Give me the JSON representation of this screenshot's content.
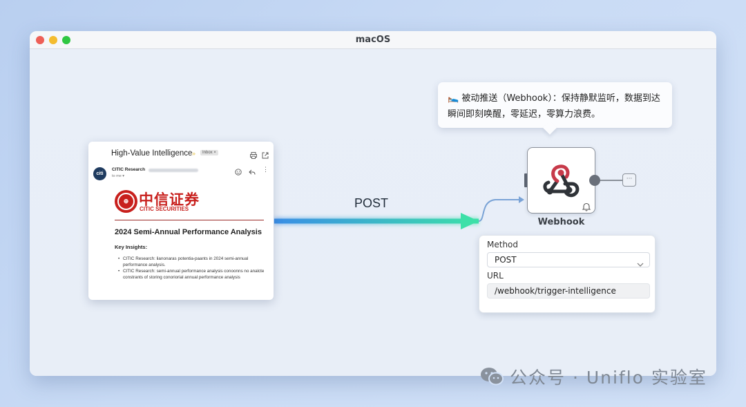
{
  "window": {
    "title": "macOS"
  },
  "email": {
    "subject": "High-Value Intelligence",
    "tag": "Inbox ×",
    "sender_name": "CITIC Research",
    "to": "to me ▾",
    "avatar_text": "citi",
    "logo_cn": "中信证券",
    "logo_en": "CITIC SECURITIES",
    "doc_title": "2024 Semi-Annual Performance Analysis",
    "key_insights": "Key Insights:",
    "bullets": [
      "CITIC Research: lianonaras potentia-paants in 2024 semi-annual performance analysis.",
      "CITIC Research: semi-annual performance analysis conoonns no analcte constrants of storing conoriorial annual performance analysis"
    ]
  },
  "flow": {
    "method_label": "POST"
  },
  "tooltip": {
    "text": "🛌 被动推送（Webhook）：保持静默监听，数据到达瞬间即刻唤醒，零延迟，零算力浪费。"
  },
  "node": {
    "label": "Webhook",
    "add_glyph": "···"
  },
  "panel": {
    "method_label": "Method",
    "method_value": "POST",
    "url_label": "URL",
    "url_value": "/webhook/trigger-intelligence"
  },
  "watermark": {
    "text": "公众号 · Uniflo 实验室"
  },
  "colors": {
    "arrow_start": "#3a8ee6",
    "arrow_end": "#3de0a8",
    "citic_red": "#c8201d",
    "webhook_red": "#c73a4a",
    "webhook_dark": "#2f3338"
  }
}
